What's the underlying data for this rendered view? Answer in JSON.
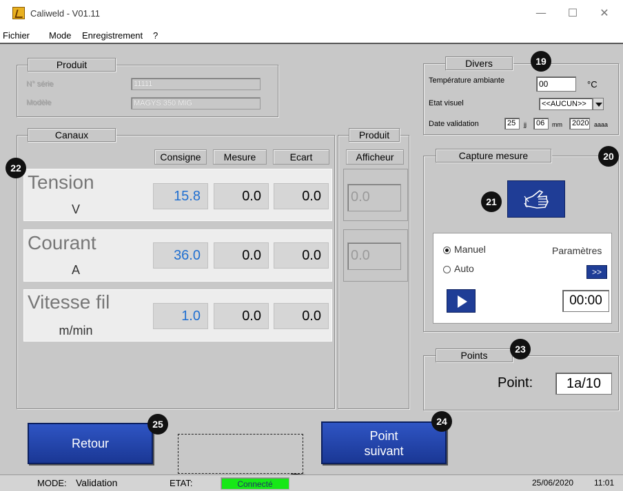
{
  "window": {
    "title": "Caliweld - V01.11"
  },
  "window_buttons": {
    "minimize": "—",
    "maximize": "☐",
    "close": "✕"
  },
  "menu": [
    "Fichier",
    "Mode",
    "Enregistrement",
    "?"
  ],
  "produit_info": {
    "title": "Produit",
    "serial_label": "N° série",
    "serial_value": "11111",
    "model_label": "Modèle",
    "model_value": "MAGYS 350 MIG"
  },
  "divers": {
    "title": "Divers",
    "temp_label": "Température ambiante",
    "temp_value": "00",
    "temp_unit": "°C",
    "etat_label": "Etat visuel",
    "etat_value": "<<AUCUN>>",
    "date_label": "Date validation",
    "day": "25",
    "day_unit": "jj",
    "month": "06",
    "month_unit": "mm",
    "year": "2020",
    "year_unit": "aaaa"
  },
  "canaux": {
    "title": "Canaux",
    "headers": [
      "Consigne",
      "Mesure",
      "Ecart"
    ],
    "rows": [
      {
        "name": "Tension",
        "unit": "V",
        "consigne": "15.8",
        "mesure": "0.0",
        "ecart": "0.0"
      },
      {
        "name": "Courant",
        "unit": "A",
        "consigne": "36.0",
        "mesure": "0.0",
        "ecart": "0.0"
      },
      {
        "name": "Vitesse fil",
        "unit": "m/min",
        "consigne": "1.0",
        "mesure": "0.0",
        "ecart": "0.0"
      }
    ]
  },
  "produit_display": {
    "title": "Produit",
    "header": "Afficheur",
    "values": [
      "0.0",
      "0.0"
    ]
  },
  "capture": {
    "title": "Capture mesure",
    "mode_manuel": "Manuel",
    "mode_auto": "Auto",
    "params_label": "Paramètres",
    "params_button": ">>",
    "timer": "00:00"
  },
  "points": {
    "title": "Points",
    "label": "Point:",
    "value": "1a/10"
  },
  "buttons": {
    "retour": "Retour",
    "next_line1": "Point",
    "next_line2": "suivant"
  },
  "badges": [
    "19",
    "20",
    "21",
    "22",
    "23",
    "24",
    "25"
  ],
  "status": {
    "mode_label": "MODE:",
    "mode_value": "Validation",
    "etat_label": "ETAT:",
    "etat_value": "Connecté",
    "date": "25/06/2020",
    "time": "11:01"
  },
  "colors": {
    "connected": "#17e817",
    "accent_blue": "#1f3d96",
    "value_blue": "#1f6fd1"
  }
}
